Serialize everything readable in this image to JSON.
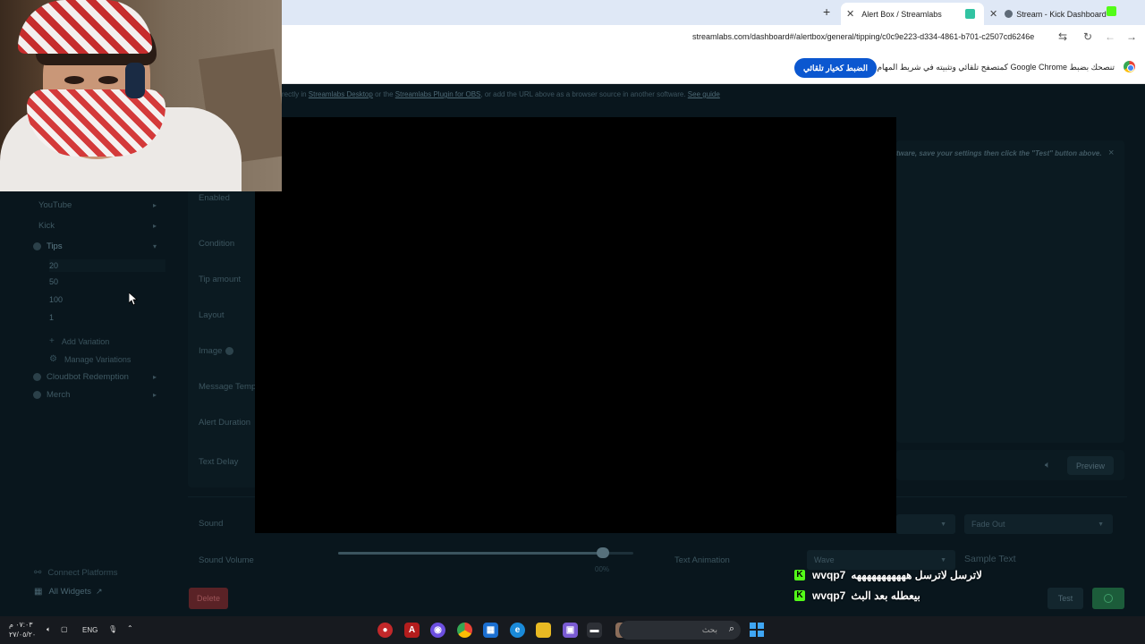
{
  "browser": {
    "tabs": [
      {
        "title": "Alert Box / Streamlabs",
        "active": true
      },
      {
        "title": "Stream - Kick Dashboard",
        "active": false
      }
    ],
    "new_tab": "+",
    "url": "streamlabs.com/dashboard#/alertbox/general/tipping/c0c9e223-d334-4861-b701-c2507cd6246e",
    "infobar": {
      "message": "تنصحك بضبط Google Chrome كمتصفح تلقائي وتثبيته في شريط المهام",
      "button": "الضبط كخيار تلقائي"
    }
  },
  "page": {
    "notice": {
      "prefix": "rectly in",
      "link1": "Streamlabs Desktop",
      "mid1": "or the",
      "link2": "Streamlabs Plugin for OBS",
      "mid2": ", or add the URL above as a browser source in another software.",
      "link3": "See guide"
    },
    "sidebar": {
      "platforms": [
        {
          "label": "YouTube"
        },
        {
          "label": "Kick"
        },
        {
          "label": "Tips"
        }
      ],
      "variations": [
        "20",
        "50",
        "100",
        "1"
      ],
      "add_variation": "Add Variation",
      "manage_variations": "Manage Variations",
      "others": [
        {
          "label": "Cloudbot Redemption"
        },
        {
          "label": "Merch"
        }
      ],
      "connect_platforms": "Connect Platforms",
      "all_widgets": "All Widgets"
    },
    "form": {
      "labels": {
        "enabled": "Enabled",
        "condition": "Condition",
        "tip_amount": "Tip amount",
        "layout": "Layout",
        "image": "Image",
        "message_template": "Message Temp",
        "alert_duration": "Alert Duration",
        "text_delay": "Text Delay",
        "sound": "Sound",
        "sound_volume": "Sound Volume",
        "text_animation": "Text Animation"
      },
      "sound_volume_value": "00%",
      "sound_volume_level": 0.9,
      "text_animation": "Wave",
      "fade": "Fade Out",
      "sample_text": "Sample Text"
    },
    "preview": {
      "hint": "tware, save your settings then click the \"Test\" button above.",
      "close": "×",
      "button": "Preview"
    },
    "buttons": {
      "delete": "Delete",
      "test": "Test"
    }
  },
  "chat": [
    {
      "user": "wvqp7",
      "message": "لاترسل لاترسل هههههههههههه"
    },
    {
      "user": "wvqp7",
      "message": "بيعطله بعد البث"
    }
  ],
  "taskbar": {
    "time": "٠٧:٠٣ م",
    "date": "٢٧/٠٥/٢٠",
    "language": "ENG",
    "search_placeholder": "بحث"
  },
  "colors": {
    "kick_green": "#53fc18",
    "chrome_blue": "#0b57d0",
    "page_bg": "#09161d"
  }
}
